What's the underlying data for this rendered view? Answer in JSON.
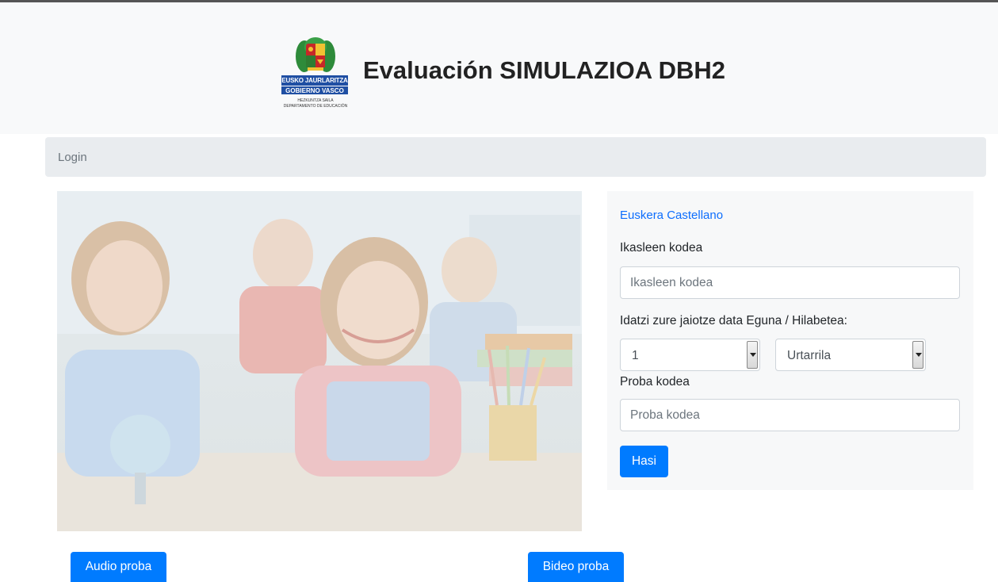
{
  "header": {
    "title": "Evaluación SIMULAZIOA DBH2",
    "logo": {
      "line1": "EUSKO JAURLARITZA",
      "line2": "GOBIERNO VASCO",
      "line3": "HEZKUNTZA SAILA",
      "line4": "DEPARTAMENTO DE EDUCACIÓN"
    }
  },
  "breadcrumb": {
    "label": "Login"
  },
  "form": {
    "language_links": "Euskera Castellano",
    "student_code_label": "Ikasleen kodea",
    "student_code_placeholder": "Ikasleen kodea",
    "birthdate_label": "Idatzi zure jaiotze data Eguna / Hilabetea:",
    "day_value": "1",
    "month_value": "Urtarrila",
    "test_code_label": "Proba kodea",
    "test_code_placeholder": "Proba kodea",
    "submit_label": "Hasi"
  },
  "footer": {
    "audio_button": "Audio proba",
    "video_button": "Bideo proba"
  },
  "colors": {
    "primary": "#007bff",
    "link": "#0d6efd",
    "logo_blue": "#1f4fa3",
    "header_bg": "#f8f9fa",
    "breadcrumb_bg": "#e9ecef"
  }
}
